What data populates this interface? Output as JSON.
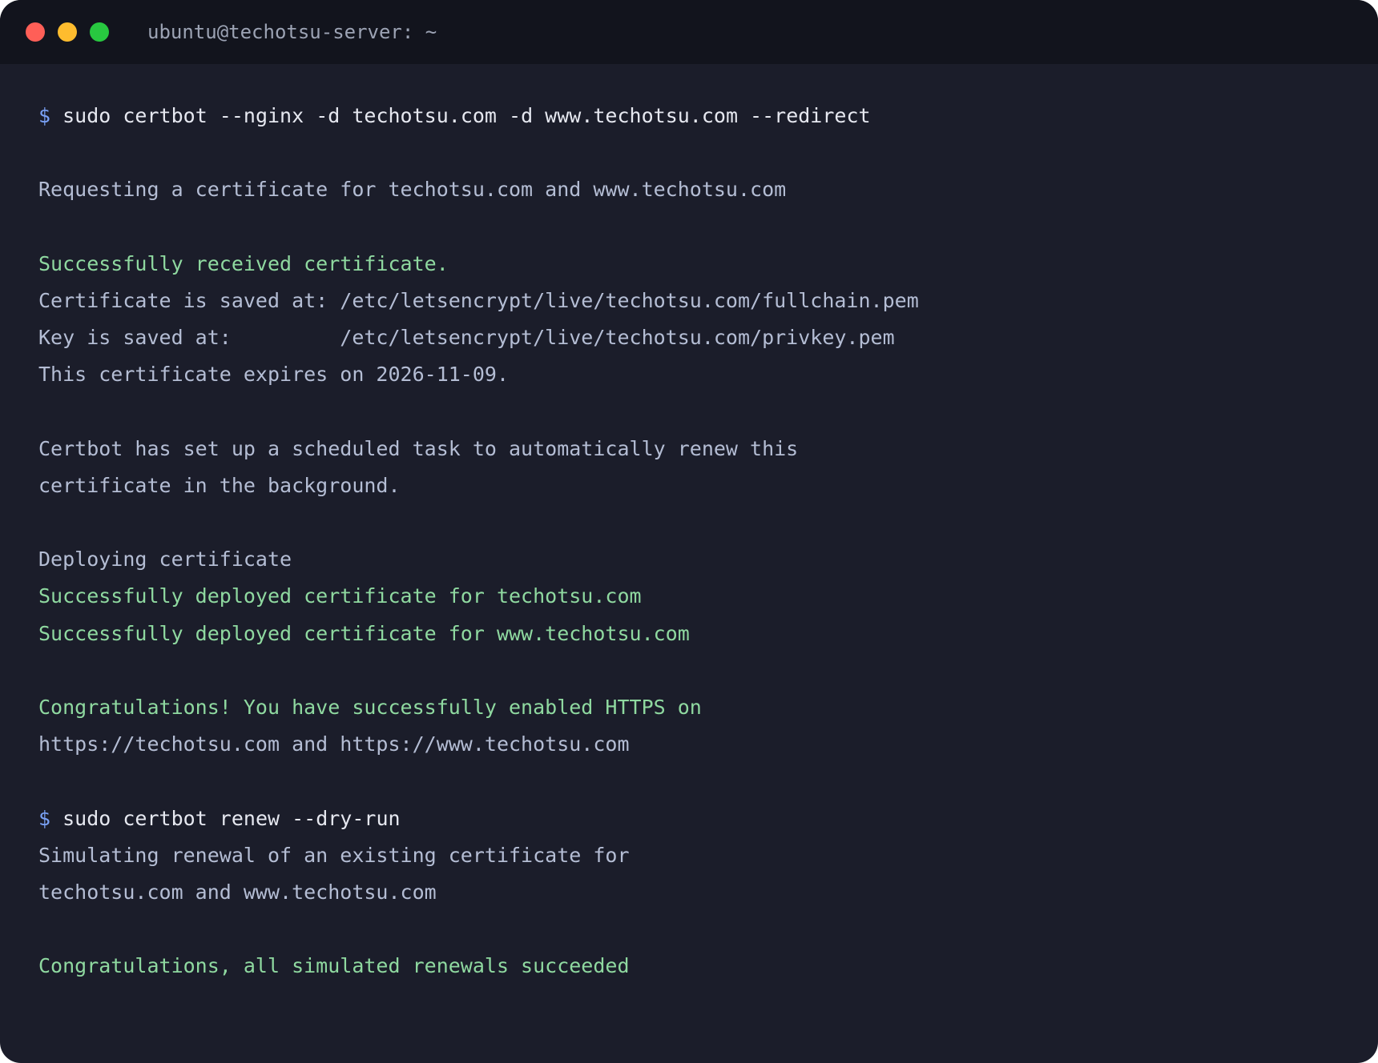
{
  "window": {
    "title": "ubuntu@techotsu-server: ~",
    "controls": {
      "close_color": "#ff5f57",
      "minimize_color": "#febc2e",
      "maximize_color": "#28c840"
    }
  },
  "colors": {
    "background": "#1b1d2a",
    "titlebar": "#12141d",
    "prompt": "#7aa2f7",
    "command": "#e6e8f0",
    "output": "#b4bdd4",
    "success": "#8fd9a0"
  },
  "terminal": {
    "lines": [
      {
        "kind": "command",
        "prompt": "$",
        "text": "sudo certbot --nginx -d techotsu.com -d www.techotsu.com --redirect"
      },
      {
        "kind": "blank",
        "text": ""
      },
      {
        "kind": "output",
        "text": "Requesting a certificate for techotsu.com and www.techotsu.com"
      },
      {
        "kind": "blank",
        "text": ""
      },
      {
        "kind": "success",
        "text": "Successfully received certificate."
      },
      {
        "kind": "output",
        "text": "Certificate is saved at: /etc/letsencrypt/live/techotsu.com/fullchain.pem"
      },
      {
        "kind": "output",
        "text": "Key is saved at:         /etc/letsencrypt/live/techotsu.com/privkey.pem"
      },
      {
        "kind": "output",
        "text": "This certificate expires on 2026-11-09."
      },
      {
        "kind": "blank",
        "text": ""
      },
      {
        "kind": "output",
        "text": "Certbot has set up a scheduled task to automatically renew this"
      },
      {
        "kind": "output",
        "text": "certificate in the background."
      },
      {
        "kind": "blank",
        "text": ""
      },
      {
        "kind": "output",
        "text": "Deploying certificate"
      },
      {
        "kind": "success",
        "text": "Successfully deployed certificate for techotsu.com"
      },
      {
        "kind": "success",
        "text": "Successfully deployed certificate for www.techotsu.com"
      },
      {
        "kind": "blank",
        "text": ""
      },
      {
        "kind": "success",
        "text": "Congratulations! You have successfully enabled HTTPS on"
      },
      {
        "kind": "output",
        "text": "https://techotsu.com and https://www.techotsu.com"
      },
      {
        "kind": "blank",
        "text": ""
      },
      {
        "kind": "command",
        "prompt": "$",
        "text": "sudo certbot renew --dry-run"
      },
      {
        "kind": "output",
        "text": "Simulating renewal of an existing certificate for"
      },
      {
        "kind": "output",
        "text": "techotsu.com and www.techotsu.com"
      },
      {
        "kind": "blank",
        "text": ""
      },
      {
        "kind": "success",
        "text": "Congratulations, all simulated renewals succeeded"
      }
    ]
  }
}
